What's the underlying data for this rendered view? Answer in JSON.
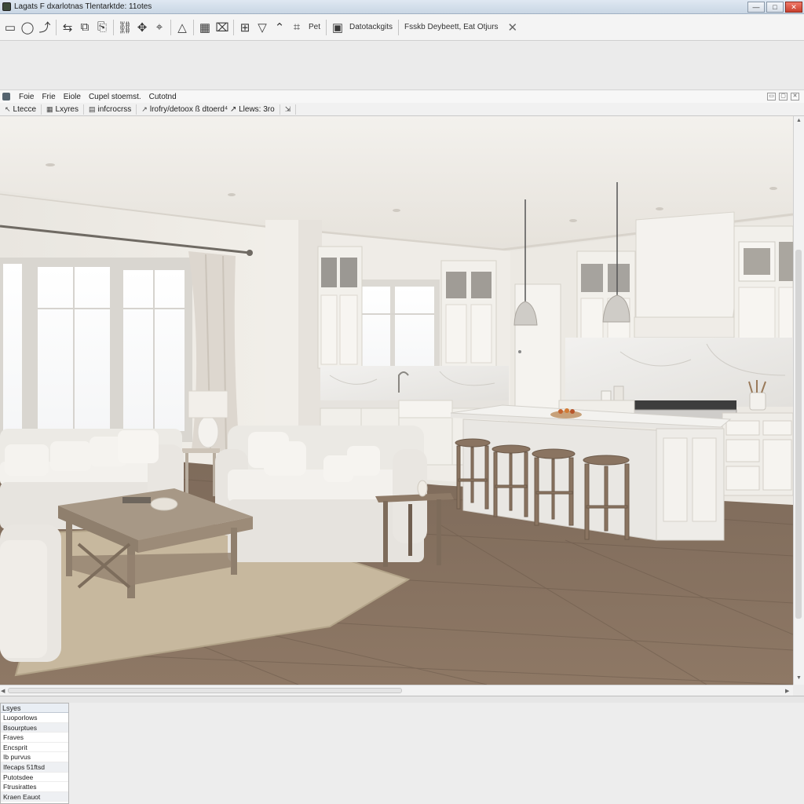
{
  "window": {
    "title": "Lagats F dxarlotnas Tlentarktde: 11otes",
    "min_label": "—",
    "max_label": "□",
    "close_label": "✕"
  },
  "toolbar": {
    "icons": [
      "file-icon",
      "lasso-icon",
      "open-icon",
      "arrows-icon",
      "copy-icon",
      "page-icon",
      "link-icon",
      "move-icon",
      "pin-icon",
      "triangle-icon",
      "calendar-icon",
      "device-icon",
      "grid-icon",
      "filter-icon",
      "pointer-icon",
      "crop-icon"
    ],
    "text_1": "Pet",
    "text_2": "Datotackgits",
    "text_3": "Fsskb Deybeett, Eat Otjurs",
    "close_label": "✕"
  },
  "document": {
    "menu": [
      "Foie",
      "Frie",
      "Eiole",
      "Cupel stoemst.",
      "Cutotnd"
    ],
    "toolbar": [
      {
        "glyph": "↖",
        "label": "Ltecce"
      },
      {
        "glyph": "▦",
        "label": "Lxyres"
      },
      {
        "glyph": "▤",
        "label": "infcrocrss"
      },
      {
        "glyph": "↗",
        "label": "lrofry/detoox ß dtoerd⁴ ↗ Llews: 3ro"
      },
      {
        "glyph": "⇲",
        "label": ""
      }
    ],
    "restore_label": "▭",
    "max_label": "▢",
    "close_label": "✕"
  },
  "viewport": {
    "scene": "render-kitchen-living-room"
  },
  "layers": {
    "header": "Lsyes",
    "items": [
      "Luoporlows",
      "Bsourptues",
      "Fraves",
      "Encsprit",
      "Ib purvus",
      "Ifecaps 51ftsd",
      "Putotsdee",
      "Ftrusirattes",
      "Kraen Eauot"
    ]
  },
  "colors": {
    "titlebar": "#c9d6e4",
    "floor": "#8a7460",
    "wall": "#efece6",
    "cabinet": "#f1efea"
  }
}
